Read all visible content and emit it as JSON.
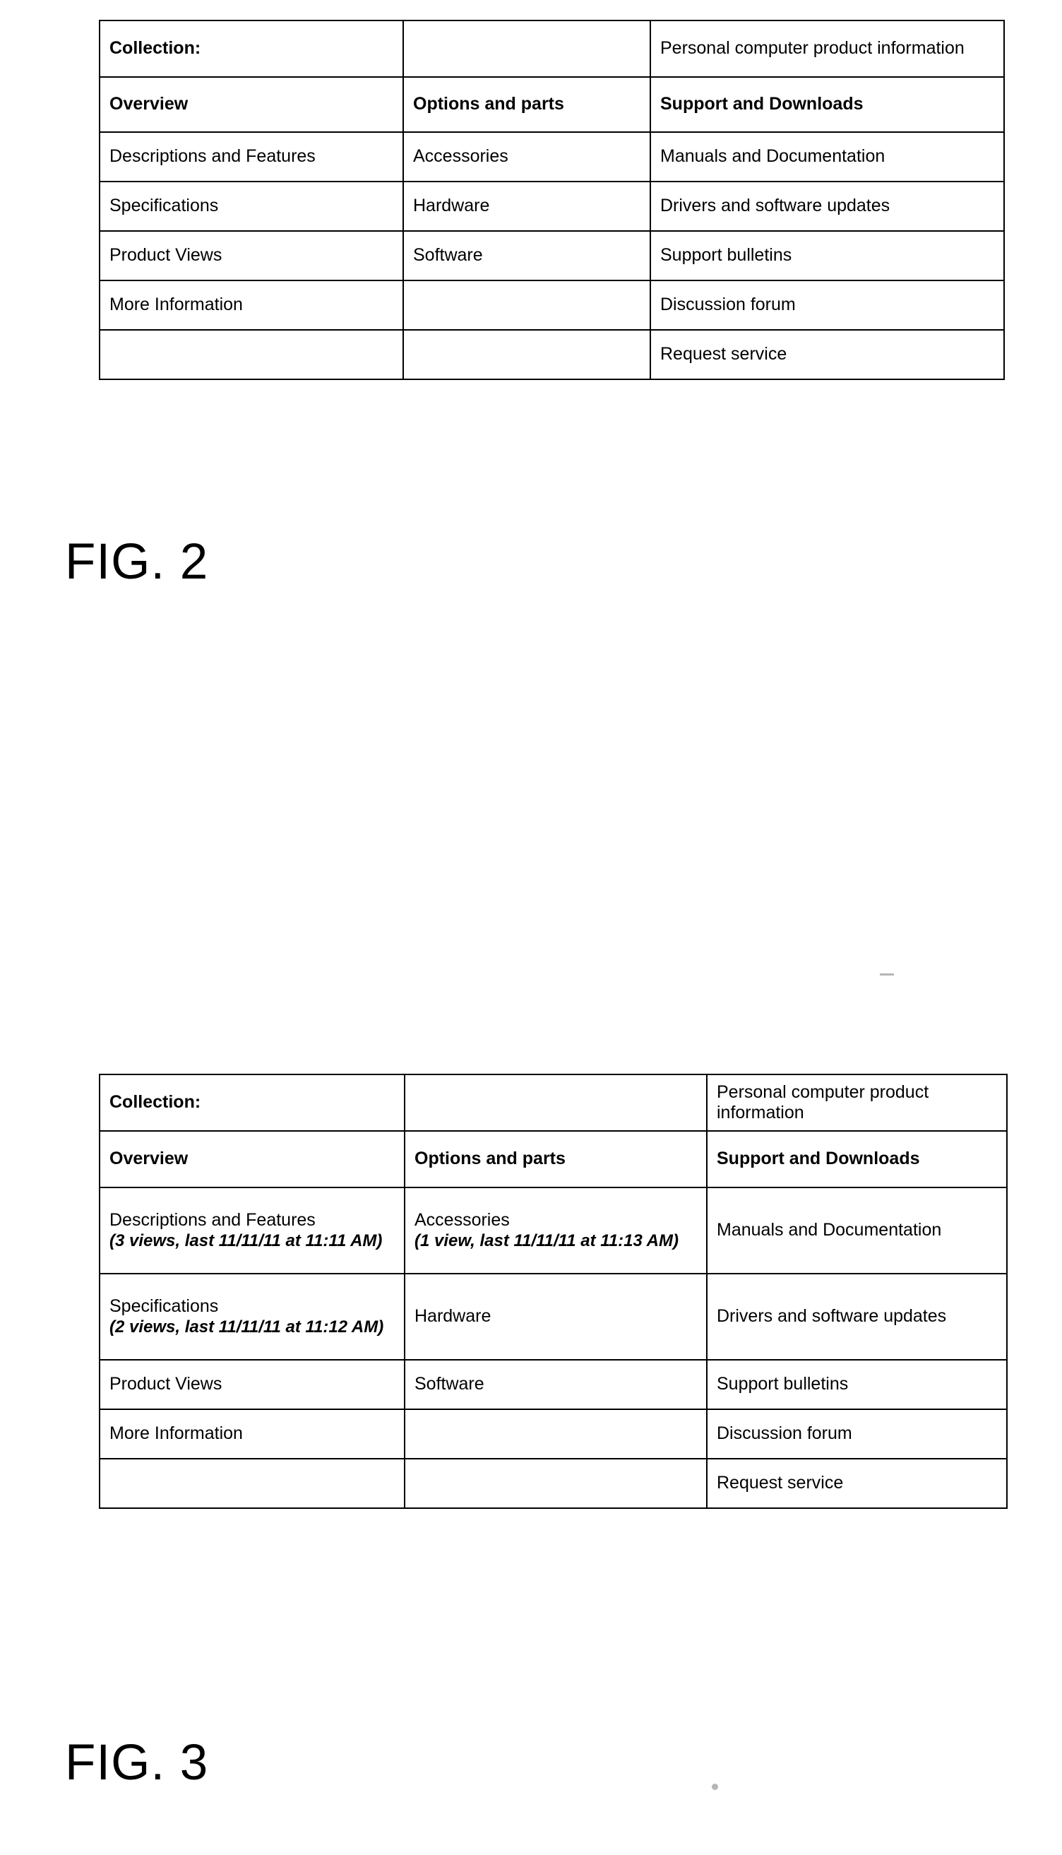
{
  "figures": [
    {
      "caption": "FIG. 2",
      "table": {
        "rows": [
          {
            "cells": [
              {
                "label": "Collection:",
                "bold": true
              },
              {
                "label": ""
              },
              {
                "label": "Personal computer product information"
              }
            ]
          },
          {
            "cells": [
              {
                "label": "Overview",
                "bold": true
              },
              {
                "label": "Options and parts",
                "bold": true
              },
              {
                "label": "Support and Downloads",
                "bold": true
              }
            ]
          },
          {
            "cells": [
              {
                "label": "Descriptions and Features"
              },
              {
                "label": "Accessories"
              },
              {
                "label": "Manuals and Documentation"
              }
            ]
          },
          {
            "cells": [
              {
                "label": "Specifications"
              },
              {
                "label": "Hardware"
              },
              {
                "label": "Drivers and software updates"
              }
            ]
          },
          {
            "cells": [
              {
                "label": "Product Views"
              },
              {
                "label": "Software"
              },
              {
                "label": "Support bulletins"
              }
            ]
          },
          {
            "cells": [
              {
                "label": "More Information"
              },
              {
                "label": ""
              },
              {
                "label": "Discussion forum"
              }
            ]
          },
          {
            "cells": [
              {
                "label": ""
              },
              {
                "label": ""
              },
              {
                "label": "Request service"
              }
            ]
          }
        ]
      }
    },
    {
      "caption": "FIG. 3",
      "table": {
        "rows": [
          {
            "cells": [
              {
                "label": "Collection:",
                "bold": true
              },
              {
                "label": ""
              },
              {
                "label": "Personal computer product information"
              }
            ]
          },
          {
            "cells": [
              {
                "label": "Overview",
                "bold": true
              },
              {
                "label": "Options and parts",
                "bold": true
              },
              {
                "label": "Support and Downloads",
                "bold": true
              }
            ]
          },
          {
            "cells": [
              {
                "label": "Descriptions and Features",
                "views": "(3 views, last 11/11/11 at 11:11 AM)"
              },
              {
                "label": "Accessories",
                "views": "(1 view, last 11/11/11 at 11:13 AM)"
              },
              {
                "label": "Manuals and Documentation"
              }
            ]
          },
          {
            "cells": [
              {
                "label": "Specifications",
                "views": "(2 views, last 11/11/11 at 11:12 AM)"
              },
              {
                "label": "Hardware"
              },
              {
                "label": "Drivers and software updates"
              }
            ]
          },
          {
            "cells": [
              {
                "label": "Product Views"
              },
              {
                "label": "Software"
              },
              {
                "label": "Support bulletins"
              }
            ]
          },
          {
            "cells": [
              {
                "label": "More Information"
              },
              {
                "label": ""
              },
              {
                "label": "Discussion forum"
              }
            ]
          },
          {
            "cells": [
              {
                "label": ""
              },
              {
                "label": ""
              },
              {
                "label": "Request service"
              }
            ]
          }
        ]
      }
    }
  ]
}
